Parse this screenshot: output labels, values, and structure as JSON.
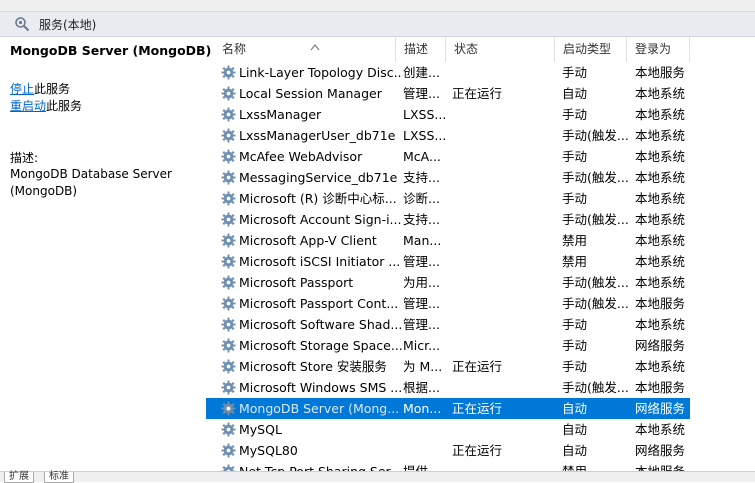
{
  "header": {
    "title": "服务(本地)",
    "icon": "services-icon"
  },
  "left_panel": {
    "service_name": "MongoDB Server (MongoDB)",
    "stop_link": "停止",
    "stop_suffix": "此服务",
    "restart_link": "重启动",
    "restart_suffix": "此服务",
    "desc_label": "描述:",
    "desc_text": "MongoDB Database Server (MongoDB)"
  },
  "columns": {
    "name": "名称",
    "desc": "描述",
    "status": "状态",
    "startup": "启动类型",
    "logon": "登录为"
  },
  "rows": [
    {
      "name": "Link-Layer Topology Disc...",
      "desc": "创建...",
      "status": "",
      "startup": "手动",
      "logon": "本地服务"
    },
    {
      "name": "Local Session Manager",
      "desc": "管理...",
      "status": "正在运行",
      "startup": "自动",
      "logon": "本地系统"
    },
    {
      "name": "LxssManager",
      "desc": "LXSS...",
      "status": "",
      "startup": "手动",
      "logon": "本地系统"
    },
    {
      "name": "LxssManagerUser_db71e",
      "desc": "LXSS...",
      "status": "",
      "startup": "手动(触发...",
      "logon": "本地系统"
    },
    {
      "name": "McAfee WebAdvisor",
      "desc": "McA...",
      "status": "",
      "startup": "手动",
      "logon": "本地系统"
    },
    {
      "name": "MessagingService_db71e",
      "desc": "支持...",
      "status": "",
      "startup": "手动(触发...",
      "logon": "本地系统"
    },
    {
      "name": "Microsoft (R) 诊断中心标...",
      "desc": "诊断...",
      "status": "",
      "startup": "手动",
      "logon": "本地系统"
    },
    {
      "name": "Microsoft Account Sign-i...",
      "desc": "支持...",
      "status": "",
      "startup": "手动(触发...",
      "logon": "本地系统"
    },
    {
      "name": "Microsoft App-V Client",
      "desc": "Man...",
      "status": "",
      "startup": "禁用",
      "logon": "本地系统"
    },
    {
      "name": "Microsoft iSCSI Initiator ...",
      "desc": "管理...",
      "status": "",
      "startup": "禁用",
      "logon": "本地系统"
    },
    {
      "name": "Microsoft Passport",
      "desc": "为用...",
      "status": "",
      "startup": "手动(触发...",
      "logon": "本地系统"
    },
    {
      "name": "Microsoft Passport Cont...",
      "desc": "管理...",
      "status": "",
      "startup": "手动(触发...",
      "logon": "本地服务"
    },
    {
      "name": "Microsoft Software Shad...",
      "desc": "管理...",
      "status": "",
      "startup": "手动",
      "logon": "本地系统"
    },
    {
      "name": "Microsoft Storage Space...",
      "desc": "Micr...",
      "status": "",
      "startup": "手动",
      "logon": "网络服务"
    },
    {
      "name": "Microsoft Store 安装服务",
      "desc": "为 M...",
      "status": "正在运行",
      "startup": "手动",
      "logon": "本地系统"
    },
    {
      "name": "Microsoft Windows SMS ...",
      "desc": "根据...",
      "status": "",
      "startup": "手动(触发...",
      "logon": "本地服务"
    },
    {
      "name": "MongoDB Server (Mong...",
      "desc": "Mon...",
      "status": "正在运行",
      "startup": "自动",
      "logon": "网络服务",
      "selected": true
    },
    {
      "name": "MySQL",
      "desc": "",
      "status": "",
      "startup": "自动",
      "logon": "本地系统"
    },
    {
      "name": "MySQL80",
      "desc": "",
      "status": "正在运行",
      "startup": "自动",
      "logon": "网络服务"
    },
    {
      "name": "Net.Tcp Port Sharing Ser...",
      "desc": "提供...",
      "status": "",
      "startup": "禁用",
      "logon": "本地服务"
    }
  ],
  "tabs": [
    "扩展",
    "标准"
  ],
  "colors": {
    "selected_bg": "#0078d7",
    "link": "#0066cc",
    "header_bg": "#e9edf2"
  }
}
